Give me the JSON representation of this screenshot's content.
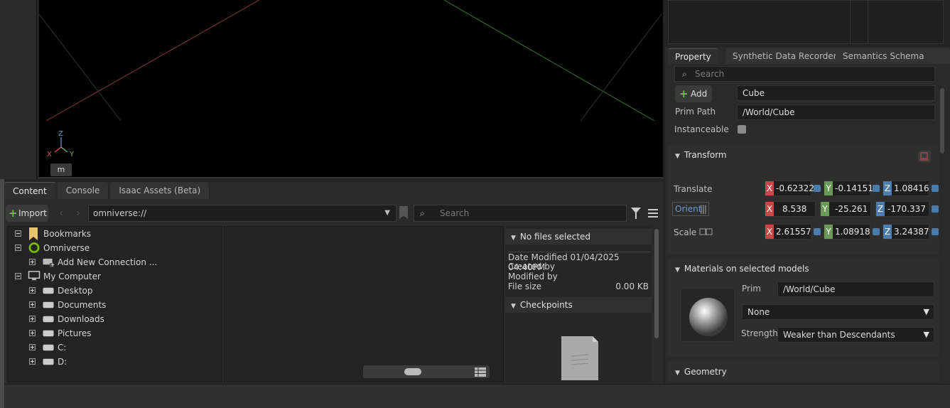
{
  "viewport": {
    "axis_labels": {
      "x": "X",
      "y": "Y",
      "z": "Z"
    },
    "unit": "m"
  },
  "content": {
    "tabs": [
      "Content",
      "Console",
      "Isaac Assets (Beta)"
    ],
    "import_label": "Import",
    "path_value": "omniverse://",
    "search_placeholder": "Search",
    "tree": [
      {
        "label": "Bookmarks",
        "icon": "bookmark-icon",
        "expanded": true
      },
      {
        "label": "Omniverse",
        "icon": "omniverse-icon",
        "expanded": true
      },
      {
        "label": "Add New Connection ...",
        "icon": "add-connection-icon",
        "expanded": false
      },
      {
        "label": "My Computer",
        "icon": "computer-icon",
        "expanded": true
      },
      {
        "label": "Desktop",
        "icon": "drive-icon",
        "expanded": false
      },
      {
        "label": "Documents",
        "icon": "drive-icon",
        "expanded": false
      },
      {
        "label": "Downloads",
        "icon": "drive-icon",
        "expanded": false
      },
      {
        "label": "Pictures",
        "icon": "drive-icon",
        "expanded": false
      },
      {
        "label": "C:",
        "icon": "drive-icon",
        "expanded": false
      },
      {
        "label": "D:",
        "icon": "drive-icon",
        "expanded": false
      }
    ],
    "details": {
      "header": "No files selected",
      "date_modified_label": "Date Modified 01/04/2025 04:40PM",
      "created_by_label": "Created by",
      "modified_by_label": "Modified by",
      "file_size_label": "File size",
      "file_size_value": "0.00 KB",
      "checkpoints_header": "Checkpoints"
    }
  },
  "property": {
    "tabs": [
      "Property",
      "Synthetic Data Recorder",
      "Semantics Schema Edit..."
    ],
    "search_placeholder": "Search",
    "add_label": "Add",
    "name_value": "Cube",
    "prim_path_label": "Prim Path",
    "prim_path_value": "/World/Cube",
    "instanceable_label": "Instanceable",
    "transform": {
      "header": "Transform",
      "translate_label": "Translate",
      "translate": {
        "x": "-0.62322",
        "y": "-0.14151",
        "z": "1.08416"
      },
      "orient_label": "Orient",
      "orient": {
        "x": "8.538",
        "y": "-25.261",
        "z": "-170.337"
      },
      "scale_label": "Scale",
      "scale": {
        "x": "2.61557",
        "y": "1.08918",
        "z": "3.24387"
      }
    },
    "materials": {
      "header": "Materials on selected models",
      "prim_label": "Prim",
      "prim_value": "/World/Cube",
      "material_value": "None",
      "strength_label": "Strength",
      "strength_value": "Weaker than Descendants"
    },
    "geometry_header": "Geometry"
  },
  "colors": {
    "axis_x": "#c84646",
    "axis_y": "#6a9a58",
    "axis_z": "#4d7eb0",
    "accent_green": "#6fbf4d"
  }
}
